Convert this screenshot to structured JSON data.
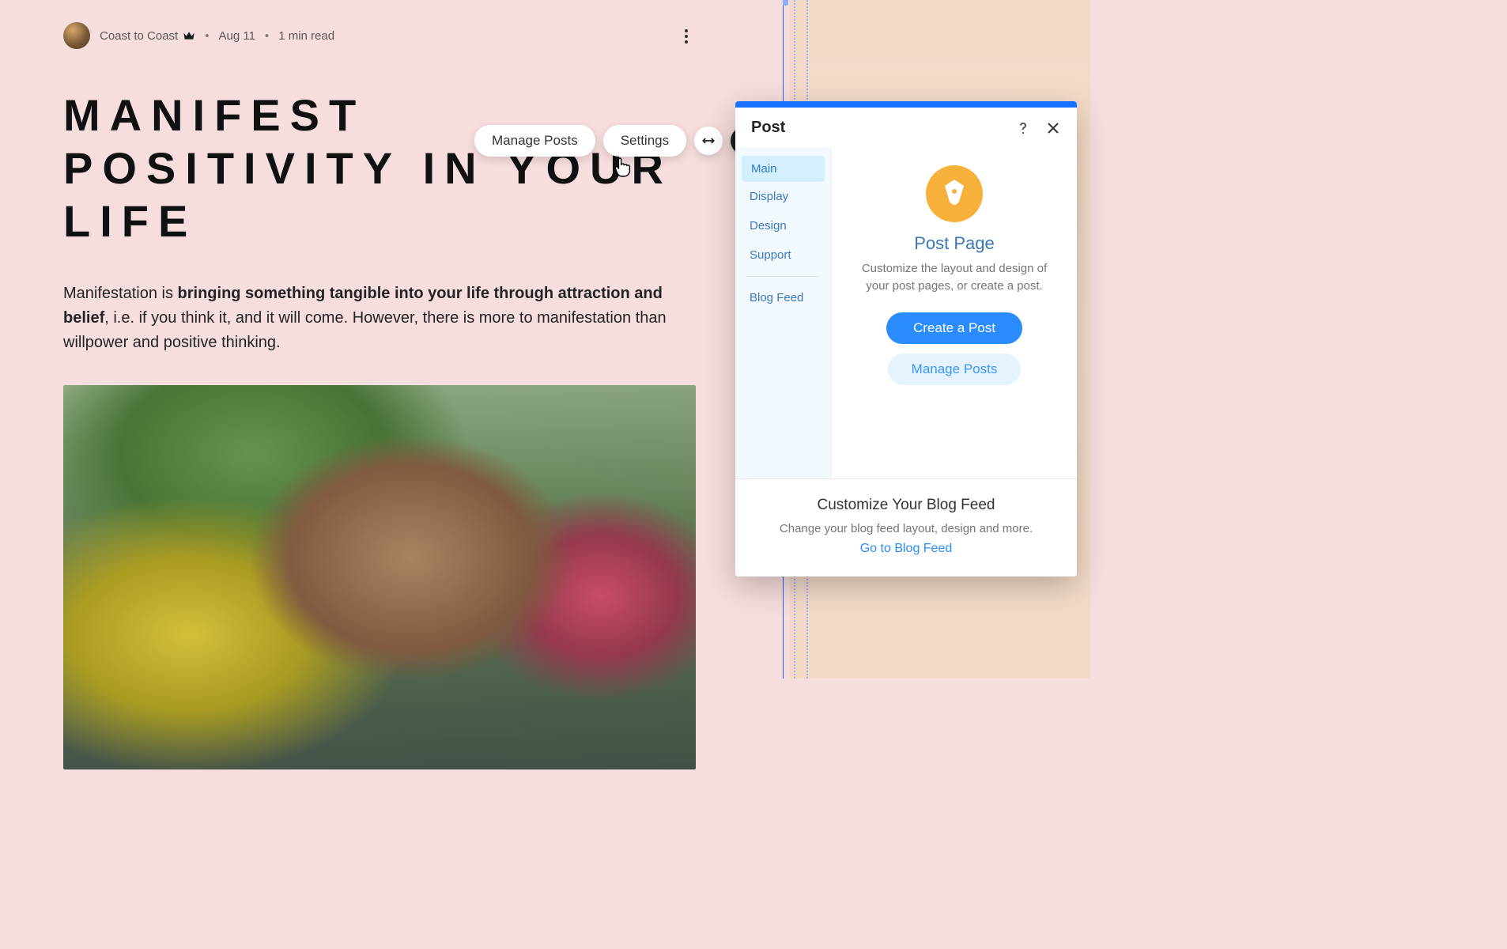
{
  "post": {
    "author": "Coast to Coast",
    "date": "Aug 11",
    "read_time": "1 min read",
    "title": "Manifest Positivity in Your Life",
    "body_prefix": "Manifestation is ",
    "body_bold": "bringing something tangible into your life through attraction and belief",
    "body_suffix": ", i.e. if you think it, and it will come. However, there is more to manifestation than willpower and positive thinking."
  },
  "toolbar": {
    "manage_posts": "Manage Posts",
    "settings": "Settings"
  },
  "panel": {
    "title": "Post",
    "nav": {
      "main": "Main",
      "display": "Display",
      "design": "Design",
      "support": "Support",
      "blog_feed": "Blog Feed"
    },
    "main": {
      "heading": "Post Page",
      "desc": "Customize the layout and design of your post pages, or create a post.",
      "create_btn": "Create a Post",
      "manage_btn": "Manage Posts"
    },
    "footer": {
      "heading": "Customize Your Blog Feed",
      "desc": "Change your blog feed layout, design and more.",
      "link": "Go to Blog Feed"
    }
  }
}
